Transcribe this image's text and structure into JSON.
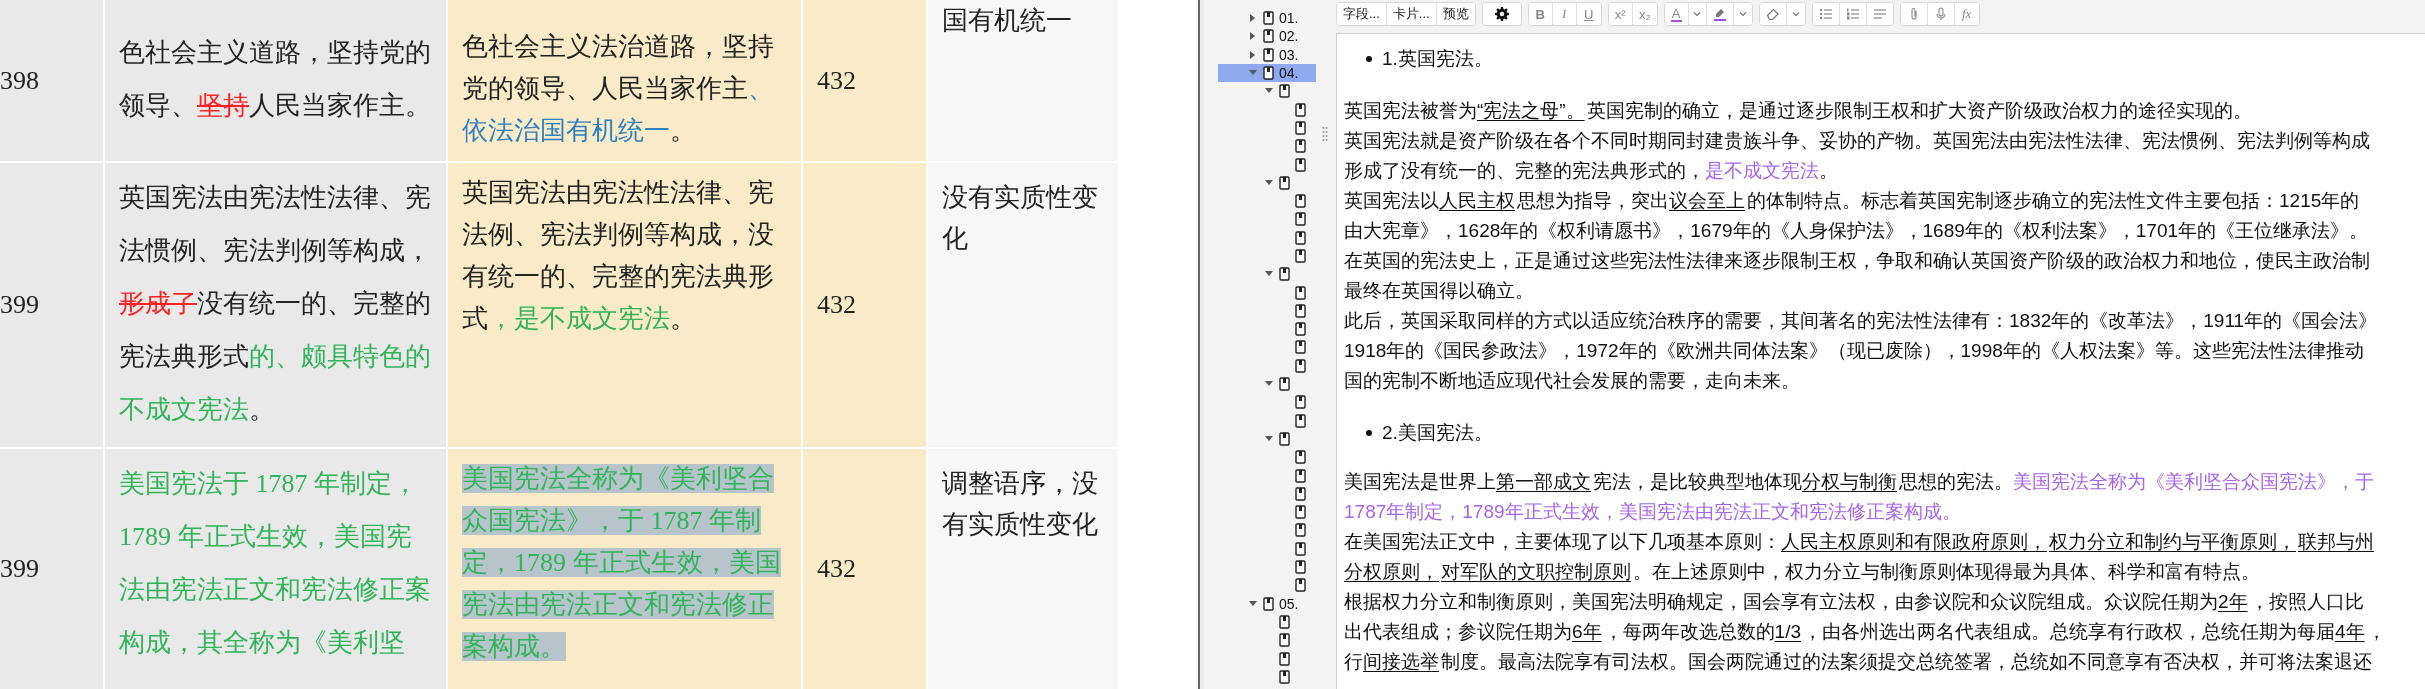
{
  "table": {
    "rows": [
      {
        "number": "398",
        "original": [
          {
            "text": "色社会主义道路，坚持党的领导、",
            "kind": "plain"
          },
          {
            "text": "坚持",
            "kind": "deleted"
          },
          {
            "text": "人民当家作主。",
            "kind": "plain"
          }
        ],
        "revised": [
          {
            "text": "色社会主义法治道路，坚持党的领导、人民当家作主",
            "kind": "plain"
          },
          {
            "text": "、依法治国有机统一",
            "kind": "changed"
          },
          {
            "text": "。",
            "kind": "plain"
          }
        ],
        "revised_highlighted": false,
        "page": "432",
        "note": "国有机统一"
      },
      {
        "number": "399",
        "original": [
          {
            "text": "英国宪法由宪法性法律、宪法惯例、宪法判例等构成，",
            "kind": "plain"
          },
          {
            "text": "形成了",
            "kind": "deleted"
          },
          {
            "text": "没有统一的、完整的宪法典形式",
            "kind": "plain"
          },
          {
            "text": "的、颇具特色的不成文宪法",
            "kind": "added"
          },
          {
            "text": "。",
            "kind": "plain"
          }
        ],
        "revised": [
          {
            "text": "英国宪法由宪法性法律、宪法例、宪法判例等构成，没有统一的、完整的宪法典形式",
            "kind": "plain"
          },
          {
            "text": "，是不成文宪法",
            "kind": "added"
          },
          {
            "text": "。",
            "kind": "plain"
          }
        ],
        "revised_highlighted": false,
        "page": "432",
        "note": "没有实质性变化"
      },
      {
        "number": "399",
        "original": [
          {
            "text": "美国宪法于 1787 年制定，1789 年正式生效，美国宪法由宪法正文和宪法修正案构成，其全称为《美利坚",
            "kind": "added"
          }
        ],
        "revised": [
          {
            "text": "美国宪法全称为《美利坚合众国宪法》，于 1787 年制定，1789 年正式生效，美国宪法由宪法正文和宪法修正案构成。",
            "kind": "added"
          }
        ],
        "revised_highlighted": true,
        "page": "432",
        "note": "调整语序，没有实质性变化"
      }
    ]
  },
  "tree": [
    {
      "label": "01.",
      "expanded": false,
      "selected": false
    },
    {
      "label": "02.",
      "expanded": false,
      "selected": false
    },
    {
      "label": "03.",
      "expanded": false,
      "selected": false
    },
    {
      "label": "04.",
      "expanded": true,
      "selected": true,
      "children": [
        {
          "expanded": true,
          "selected": false,
          "children": [
            {
              "selected": false
            },
            {
              "selected": false
            },
            {
              "selected": false
            },
            {
              "selected": false
            }
          ]
        },
        {
          "expanded": true,
          "selected": false,
          "children": [
            {
              "selected": false
            },
            {
              "selected": false
            },
            {
              "selected": false
            },
            {
              "selected": false
            }
          ]
        },
        {
          "expanded": true,
          "selected": false,
          "children": [
            {
              "selected": false
            },
            {
              "selected": false
            },
            {
              "selected": false
            },
            {
              "selected": false
            },
            {
              "selected": false
            }
          ]
        },
        {
          "expanded": true,
          "selected": false,
          "children": [
            {
              "selected": false
            },
            {
              "selected": false
            }
          ]
        },
        {
          "expanded": true,
          "selected": false,
          "children": [
            {
              "selected": false
            },
            {
              "selected": false
            },
            {
              "selected": false
            },
            {
              "selected": false
            },
            {
              "selected": false
            },
            {
              "selected": false
            },
            {
              "selected": false
            },
            {
              "selected": false
            }
          ]
        }
      ]
    },
    {
      "label": "05.",
      "expanded": true,
      "selected": false,
      "children": [
        {
          "selected": false
        },
        {
          "selected": false
        },
        {
          "selected": false
        },
        {
          "selected": false
        }
      ]
    }
  ],
  "toolbar": {
    "field_button": "字段...",
    "cards_button": "卡片...",
    "preview_button": "预览",
    "bold": "B",
    "italic": "I",
    "underline": "U",
    "superscript": "x²",
    "subscript": "x₂",
    "text_color": "A",
    "formula": "fx"
  },
  "editor": {
    "blocks": [
      {
        "kind": "bullet",
        "text": "1.英国宪法。"
      },
      {
        "kind": "paragraph",
        "lines": [
          [
            {
              "text": "英国宪法被誉为",
              "kind": "plain"
            },
            {
              "text": "“宪法之母”。",
              "kind": "underline"
            },
            {
              "text": "英国宪制的确立，是通过逐步限制王权和扩大资产阶级政治权力的途径实现的。",
              "kind": "plain"
            }
          ],
          [
            {
              "text": "英国宪法就是资产阶级在各个不同时期同封建贵族斗争、妥协的产物。英国宪法由宪法性法律、宪法惯例、宪法判例等构成",
              "kind": "plain"
            }
          ],
          [
            {
              "text": "形成了没有统一的、完整的宪法典形式的，",
              "kind": "plain"
            },
            {
              "text": "是不成文宪法",
              "kind": "accent"
            },
            {
              "text": "。",
              "kind": "plain"
            }
          ],
          [
            {
              "text": "英国宪法以",
              "kind": "plain"
            },
            {
              "text": "人民主权",
              "kind": "underline"
            },
            {
              "text": "思想为指导，突出",
              "kind": "plain"
            },
            {
              "text": "议会至上",
              "kind": "underline"
            },
            {
              "text": "的体制特点。标志着英国宪制逐步确立的宪法性文件主要包括：1215年的",
              "kind": "plain"
            }
          ],
          [
            {
              "text": "由大宪章》，1628年的《权利请愿书》，1679年的《人身保护法》，1689年的《权利法案》，1701年的《王位继承法》。",
              "kind": "plain"
            }
          ],
          [
            {
              "text": "在英国的宪法史上，正是通过这些宪法性法律来逐步限制王权，争取和确认英国资产阶级的政治权力和地位，使民主政治制",
              "kind": "plain"
            }
          ],
          [
            {
              "text": "最终在英国得以确立。",
              "kind": "plain"
            }
          ],
          [
            {
              "text": "此后，英国采取同样的方式以适应统治秩序的需要，其间著名的宪法性法律有：1832年的《改革法》，1911年的《国会法》",
              "kind": "plain"
            }
          ],
          [
            {
              "text": "1918年的《国民参政法》，1972年的《欧洲共同体法案》（现已废除），1998年的《人权法案》等。这些宪法性法律推动",
              "kind": "plain"
            }
          ],
          [
            {
              "text": "国的宪制不断地适应现代社会发展的需要，走向未来。",
              "kind": "plain"
            }
          ]
        ]
      },
      {
        "kind": "bullet",
        "text": "2.美国宪法。"
      },
      {
        "kind": "paragraph",
        "lines": [
          [
            {
              "text": "美国宪法是世界上",
              "kind": "plain"
            },
            {
              "text": "第一部成文",
              "kind": "underline"
            },
            {
              "text": "宪法，是比较典型地体现",
              "kind": "plain"
            },
            {
              "text": "分权与制衡",
              "kind": "underline"
            },
            {
              "text": "思想的宪法。",
              "kind": "plain"
            },
            {
              "text": "美国宪法全称为《美利坚合众国宪法》，于",
              "kind": "accent"
            }
          ],
          [
            {
              "text": "1787年制定，1789年正式生效，美国宪法由宪法正文和宪法修正案构成。",
              "kind": "accent"
            }
          ],
          [
            {
              "text": "在美国宪法正文中，主要体现了以下几项基本原则：",
              "kind": "plain"
            },
            {
              "text": "人民主权原则和有限政府原则，",
              "kind": "underline"
            },
            {
              "text": "权力分立和制约与平衡原则，",
              "kind": "underline"
            },
            {
              "text": "联邦与州",
              "kind": "underline"
            }
          ],
          [
            {
              "text": "分权原则，",
              "kind": "underline"
            },
            {
              "text": "对军队的文职控制原则",
              "kind": "underline"
            },
            {
              "text": "。在上述原则中，权力分立与制衡原则体现得最为具体、科学和富有特点。",
              "kind": "plain"
            }
          ],
          [
            {
              "text": "根据权力分立和制衡原则，美国宪法明确规定，国会享有立法权，由参议院和众议院组成。众议院任期为",
              "kind": "plain"
            },
            {
              "text": "2年",
              "kind": "underline"
            },
            {
              "text": "，按照人口比",
              "kind": "plain"
            }
          ],
          [
            {
              "text": "出代表组成；参议院任期为",
              "kind": "plain"
            },
            {
              "text": "6年",
              "kind": "underline"
            },
            {
              "text": "，每两年改选总数的",
              "kind": "plain"
            },
            {
              "text": "1/3",
              "kind": "underline"
            },
            {
              "text": "，由各州选出两名代表组成。总统享有行政权，总统任期为每届",
              "kind": "plain"
            },
            {
              "text": "4年",
              "kind": "underline"
            },
            {
              "text": "，",
              "kind": "plain"
            }
          ],
          [
            {
              "text": "行",
              "kind": "plain"
            },
            {
              "text": "间接选举",
              "kind": "underline"
            },
            {
              "text": "制度。最高法院享有司法权。国会两院通过的法案须提交总统签署，总统如不同意享有否决权，并可将法案退还",
              "kind": "plain"
            }
          ]
        ]
      }
    ]
  }
}
